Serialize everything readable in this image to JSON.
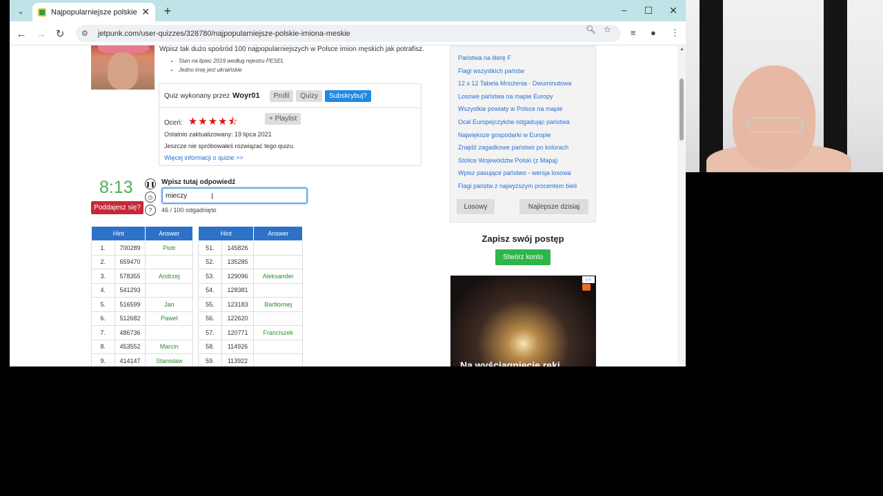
{
  "browser": {
    "tab_title": "Najpopularniejsze polskie imion",
    "url": "jetpunk.com/user-quizzes/328780/najpopularniejsze-polskie-imiona-meskie"
  },
  "quiz": {
    "intro": "Wpisz tak dużo spośród 100 najpopularniejszych w Polsce imion męskich jak potrafisz.",
    "bullets": [
      "Stan na lipiec 2019 według rejestru PESEL",
      "Jedno imię jest ukraińskie"
    ],
    "made_by_label": "Quiz wykonany przez",
    "author": "Woyr01",
    "profile_btn": "Profil",
    "quizzes_btn": "Quizy",
    "subscribe_btn": "Subskrybuj?",
    "rate_label": "Oceń:",
    "stars": "★★★★⯪",
    "playlist_btn": "+ Playlist",
    "updated": "Ostatnio zaktualizowany: 19 lipca 2021",
    "not_tried": "Jeszcze nie spróbowałeś rozwiązać tego quizu.",
    "more_info": "Więcej informacji o quizie >>",
    "timer": "8:13",
    "give_up": "Poddajesz się?",
    "answer_label": "Wpisz tutaj odpowiedź",
    "answer_value": "mieczy",
    "progress": "46 / 100 odgadnięto",
    "col_hint": "Hint",
    "col_answer": "Answer",
    "left_rows": [
      [
        "1.",
        "700289",
        "Piotr"
      ],
      [
        "2.",
        "659470",
        ""
      ],
      [
        "3.",
        "578355",
        "Andrzej"
      ],
      [
        "4.",
        "541293",
        ""
      ],
      [
        "5.",
        "516599",
        "Jan"
      ],
      [
        "6.",
        "512682",
        "Paweł"
      ],
      [
        "7.",
        "486736",
        ""
      ],
      [
        "8.",
        "453552",
        "Marcin"
      ],
      [
        "9.",
        "414147",
        "Stanisław"
      ]
    ],
    "right_rows": [
      [
        "51.",
        "145826",
        ""
      ],
      [
        "52.",
        "135285",
        ""
      ],
      [
        "53.",
        "129096",
        "Aleksander"
      ],
      [
        "54.",
        "128381",
        ""
      ],
      [
        "55.",
        "123183",
        "Bartłomiej"
      ],
      [
        "56.",
        "122620",
        ""
      ],
      [
        "57.",
        "120771",
        "Franciszek"
      ],
      [
        "58.",
        "114926",
        ""
      ],
      [
        "59.",
        "113922",
        ""
      ]
    ]
  },
  "sidebar": {
    "links": [
      "Państwa na literę F",
      "Flagi wszystkich państw",
      "12 x 12 Tabela Mnożenia - Dwuminutowa",
      "Losowe państwa na mapie Europy",
      "Wszystkie powiaty w Polsce na mapie",
      "Ocal Europejczyków odgadując państwa",
      "Największe gospodarki w Europie",
      "Znajdź zagadkowe państwo po kolorach",
      "Stolice Województw Polski (z Mapą)",
      "Wpisz pasujące państwo - wersja losowa",
      "Flagi państw z najwyższym procentem bieli"
    ],
    "random_btn": "Losowy",
    "best_today_btn": "Najlepsze dzisiaj",
    "save_title": "Zapisz swój postęp",
    "create_account": "Stwórz konto",
    "ad_text": "Na wyściągnięcie ręki"
  },
  "colors": {
    "timer": "#4caf50",
    "give_up": "#c62838",
    "table_header": "#2e72c8",
    "create_btn": "#2fb64a",
    "subscribe": "#1e88e5",
    "stars": "#dd1111"
  }
}
